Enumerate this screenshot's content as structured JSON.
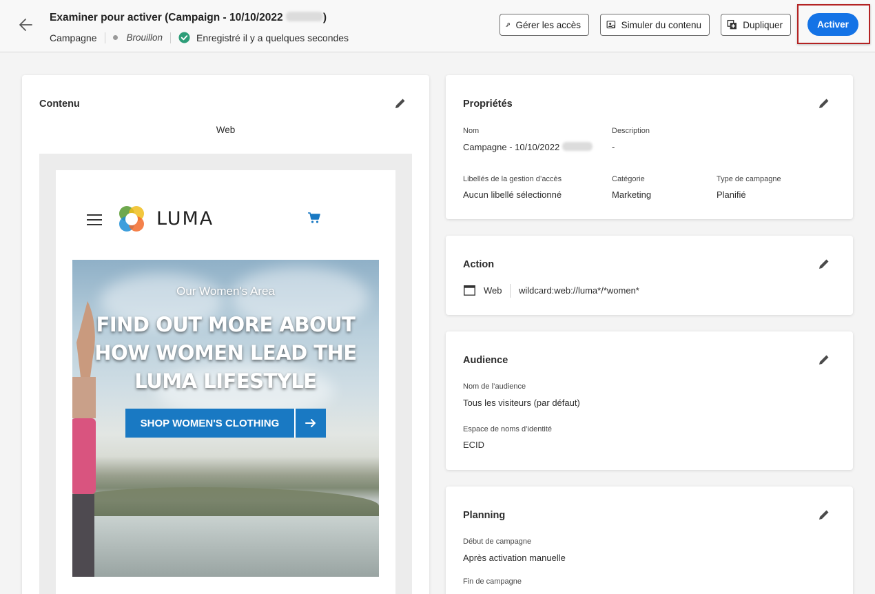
{
  "header": {
    "title": "Examiner pour activer (Campaign - 10/10/2022",
    "title_close": ")",
    "type": "Campagne",
    "status": "Brouillon",
    "save_status": "Enregistré il y a quelques secondes",
    "buttons": {
      "access": "Gérer les accès",
      "simulate": "Simuler du contenu",
      "duplicate": "Dupliquer",
      "activate": "Activer"
    }
  },
  "content": {
    "title": "Contenu",
    "channel": "Web",
    "preview": {
      "brand": "LUMA",
      "hero_subtitle": "Our Women's Area",
      "hero_headline": "FIND OUT MORE ABOUT HOW WOMEN LEAD THE LUMA LIFESTYLE",
      "cta": "SHOP WOMEN'S CLOTHING"
    }
  },
  "properties": {
    "title": "Propriétés",
    "name_label": "Nom",
    "name_value": "Campagne  - 10/10/2022",
    "description_label": "Description",
    "description_value": "-",
    "labels_label": "Libellés de la gestion d’accès",
    "labels_value": "Aucun libellé sélectionné",
    "category_label": "Catégorie",
    "category_value": "Marketing",
    "type_label": "Type de campagne",
    "type_value": "Planifié"
  },
  "action": {
    "title": "Action",
    "channel": "Web",
    "url": "wildcard:web://luma*/*women*"
  },
  "audience": {
    "title": "Audience",
    "name_label": "Nom de l’audience",
    "name_value": "Tous les visiteurs (par défaut)",
    "namespace_label": "Espace de noms d’identité",
    "namespace_value": "ECID"
  },
  "planning": {
    "title": "Planning",
    "start_label": "Début de campagne",
    "start_value": "Après activation manuelle",
    "end_label": "Fin de campagne"
  },
  "colors": {
    "accent": "#1473e6",
    "highlight": "#b42323",
    "success": "#2d9d78",
    "cta_blue": "#1979c3"
  },
  "icons": [
    "back-arrow-icon",
    "checkmark-circle-icon",
    "key-icon",
    "simulate-icon",
    "duplicate-icon",
    "pencil-icon",
    "browser-icon",
    "hamburger-icon",
    "cart-icon",
    "arrow-right-icon"
  ]
}
